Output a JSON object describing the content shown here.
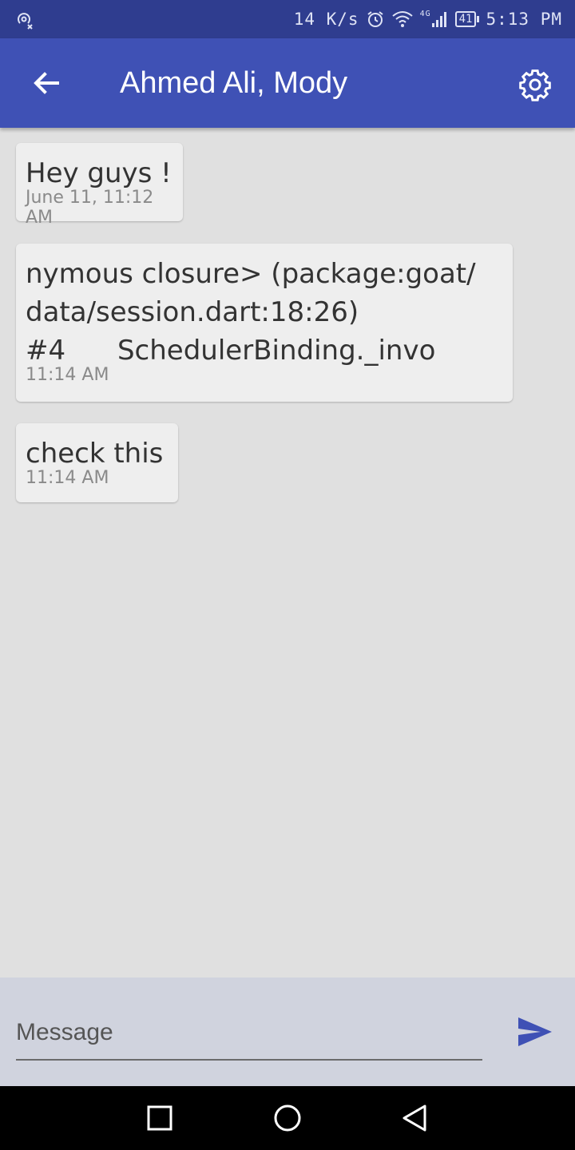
{
  "status_bar": {
    "net_speed": "14 K/s",
    "network_type": "4G",
    "battery_level": "41",
    "time": "5:13 PM",
    "icons": [
      "hotspot-icon",
      "alarm-icon",
      "wifi-icon",
      "signal-icon",
      "battery-icon"
    ]
  },
  "app_bar": {
    "title": "Ahmed Ali, Mody",
    "back_icon": "arrow-back-icon",
    "settings_icon": "gear-icon",
    "color": "#3f51b5"
  },
  "messages": [
    {
      "text": "Hey guys !",
      "time": "June 11, 11:12 AM"
    },
    {
      "text": "nymous closure> (package:goat/\ndata/session.dart:18:26)\n#4      SchedulerBinding._invo",
      "time": "11:14 AM"
    },
    {
      "text": "check this",
      "time": "11:14 AM"
    }
  ],
  "composer": {
    "placeholder": "Message",
    "value": "",
    "send_icon": "send-icon",
    "accent": "#3f51b5"
  },
  "nav_bar": {
    "buttons": [
      "recents-square-icon",
      "home-circle-icon",
      "back-triangle-icon"
    ]
  }
}
